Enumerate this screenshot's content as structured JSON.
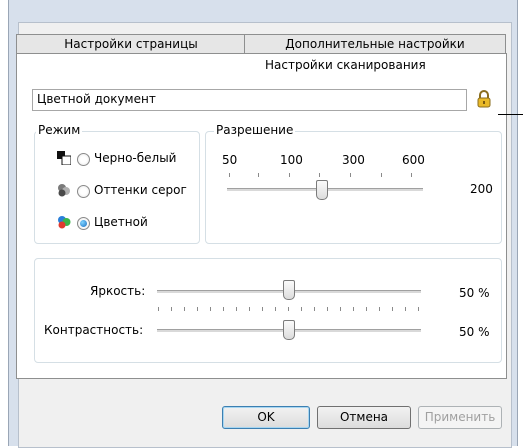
{
  "tabs": {
    "page_settings": "Настройки страницы",
    "advanced_settings": "Дополнительные настройки",
    "scan_settings": "Настройки сканирования"
  },
  "profile": {
    "name": "Цветной документ",
    "lock_icon": "padlock-icon"
  },
  "mode": {
    "legend": "Режим",
    "options": [
      {
        "label": "Черно-белый",
        "icon": "bw-mode-icon",
        "selected": false
      },
      {
        "label": "Оттенки серог",
        "icon": "grayscale-mode-icon",
        "selected": false
      },
      {
        "label": "Цветной",
        "icon": "color-mode-icon",
        "selected": true
      }
    ]
  },
  "resolution": {
    "legend": "Разрешение",
    "scale_labels": [
      "50",
      "100",
      "300",
      "600"
    ],
    "value": "200"
  },
  "adjustments": {
    "brightness_label": "Яркость:",
    "brightness_value": "50 %",
    "contrast_label": "Контрастность:",
    "contrast_value": "50 %"
  },
  "buttons": {
    "ok": "OK",
    "cancel": "Отмена",
    "apply": "Применить"
  }
}
